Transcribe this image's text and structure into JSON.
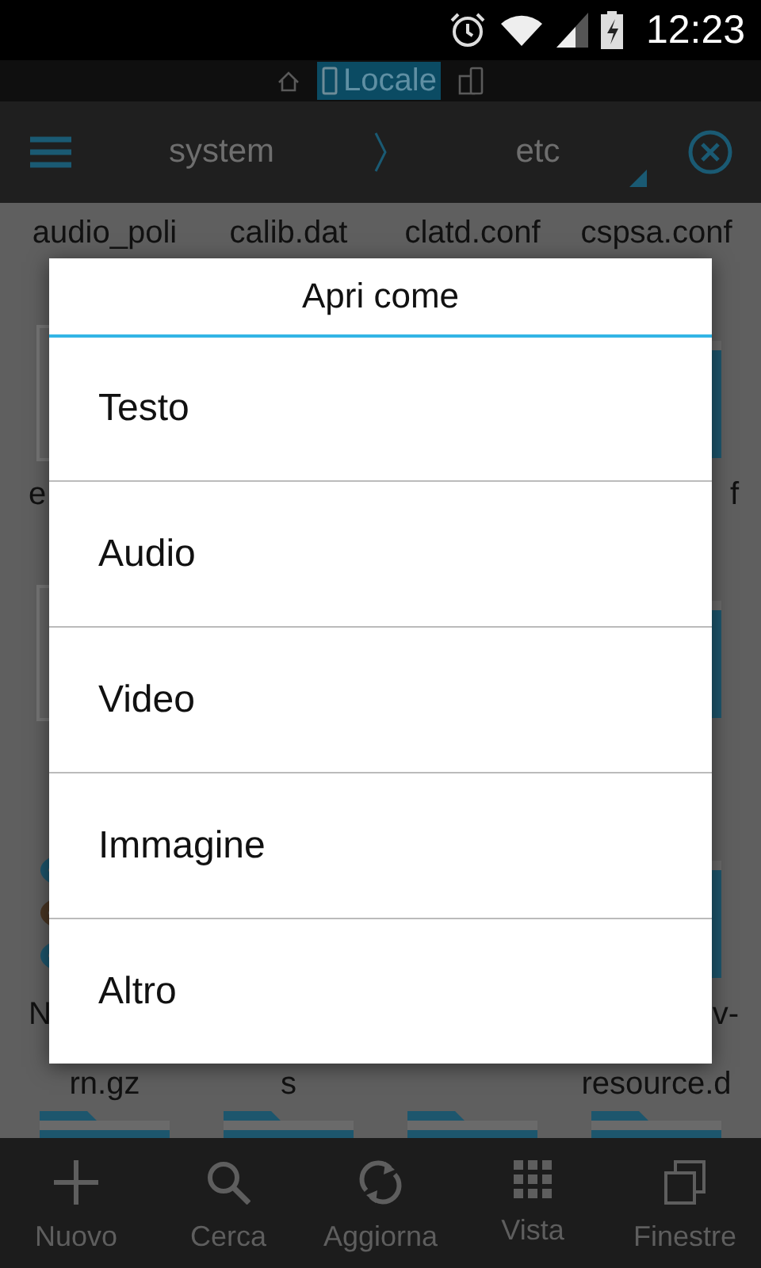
{
  "status_bar": {
    "time": "12:23"
  },
  "location_bar": {
    "tabs": [
      {
        "kind": "home",
        "selected": false
      },
      {
        "kind": "local",
        "label": "Locale",
        "selected": true
      },
      {
        "kind": "network",
        "selected": false
      }
    ]
  },
  "toolbar": {
    "path": [
      "system",
      "etc"
    ]
  },
  "files": {
    "rows": [
      {
        "covered": false,
        "tiles": [
          {
            "name": "audio_poli"
          },
          {
            "name": "calib.dat"
          },
          {
            "name": "clatd.conf"
          },
          {
            "name": "cspsa.conf"
          }
        ]
      },
      {
        "covered": true,
        "tiles": [
          {
            "kind": "file",
            "name": "e"
          },
          {
            "kind": "hidden"
          },
          {
            "kind": "hidden"
          },
          {
            "kind": "folder",
            "name": "f"
          }
        ]
      },
      {
        "tiles": [
          {
            "kind": "file"
          },
          {
            "kind": "hidden"
          },
          {
            "kind": "hidden"
          },
          {
            "kind": "folder"
          }
        ]
      },
      {
        "covered": true,
        "tiles": [
          {
            "kind": "archive",
            "name": "N",
            "name_end": "rn.gz"
          },
          {
            "kind": "hidden",
            "name_end": "s"
          },
          {
            "kind": "hidden"
          },
          {
            "kind": "folder",
            "name": "v-",
            "name_end": "resource.d"
          }
        ]
      },
      {
        "tiles": [
          {
            "kind": "folder"
          },
          {
            "kind": "folder"
          },
          {
            "kind": "folder"
          },
          {
            "kind": "folder"
          }
        ]
      }
    ]
  },
  "dialog": {
    "title": "Apri come",
    "options": [
      "Testo",
      "Audio",
      "Video",
      "Immagine",
      "Altro"
    ]
  },
  "bottom_bar": {
    "buttons": [
      {
        "kind": "new",
        "label": "Nuovo"
      },
      {
        "kind": "search",
        "label": "Cerca"
      },
      {
        "kind": "refresh",
        "label": "Aggiorna"
      },
      {
        "kind": "view",
        "label": "Vista"
      },
      {
        "kind": "windows",
        "label": "Finestre"
      }
    ]
  }
}
